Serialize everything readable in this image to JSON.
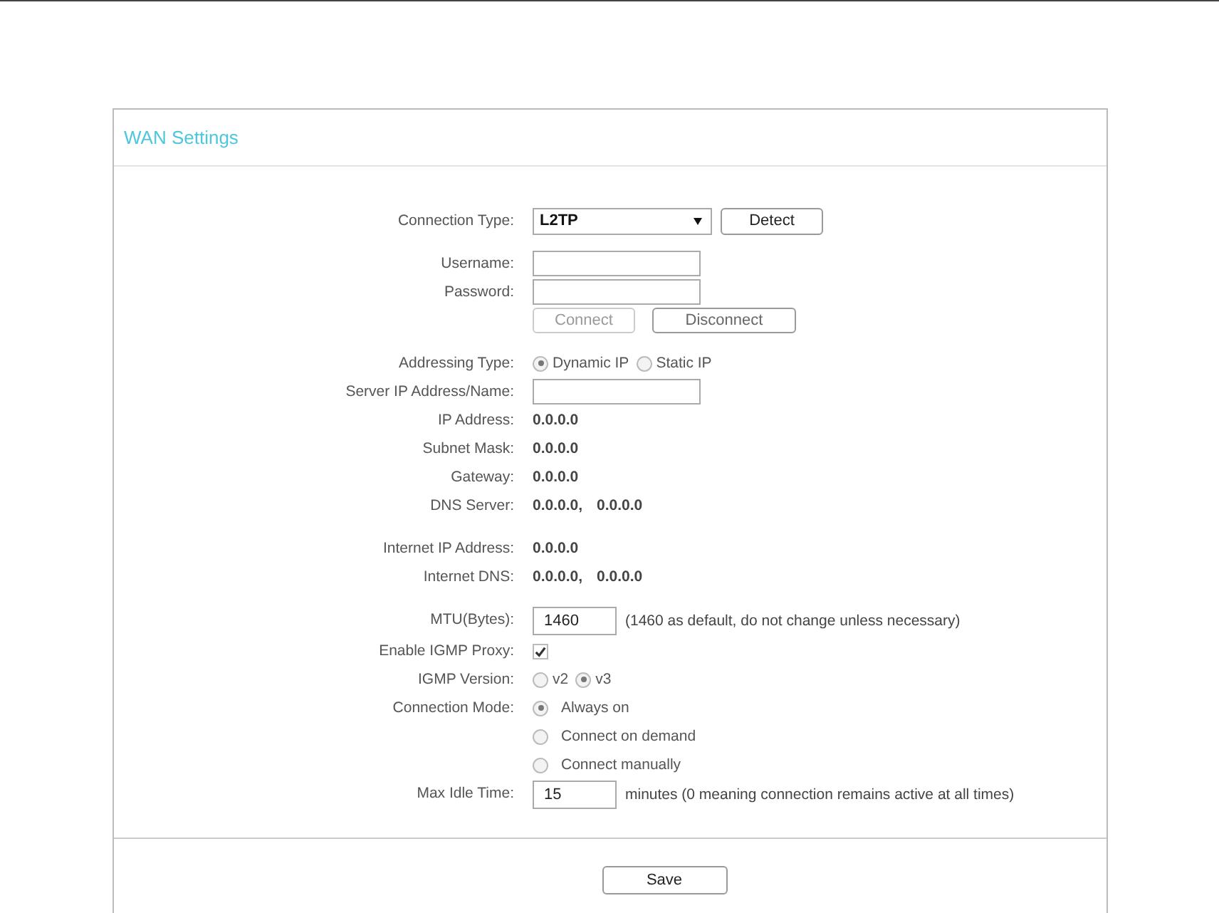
{
  "panel": {
    "title": "WAN Settings"
  },
  "sections": [
    [
      {
        "kind": "select",
        "label": "Connection Type:",
        "value": "L2TP",
        "button": "Detect"
      }
    ],
    [
      {
        "kind": "input",
        "label": "Username:"
      },
      {
        "kind": "input",
        "label": "Password:"
      },
      {
        "kind": "buttons",
        "buttons": [
          {
            "label": "Connect",
            "disabled": true
          },
          {
            "label": "Disconnect",
            "disabled": false
          }
        ]
      }
    ],
    [
      {
        "kind": "radio",
        "label": "Addressing Type:",
        "options": [
          {
            "label": "Dynamic IP",
            "selected": true
          },
          {
            "label": "Static IP",
            "selected": false
          }
        ]
      },
      {
        "kind": "input",
        "label": "Server IP Address/Name:"
      },
      {
        "kind": "value",
        "label": "IP Address:",
        "values": [
          "0.0.0.0"
        ]
      },
      {
        "kind": "value",
        "label": "Subnet Mask:",
        "values": [
          "0.0.0.0"
        ]
      },
      {
        "kind": "value",
        "label": "Gateway:",
        "values": [
          "0.0.0.0"
        ]
      },
      {
        "kind": "value",
        "label": "DNS Server:",
        "values": [
          "0.0.0.0,",
          "0.0.0.0"
        ]
      }
    ],
    [
      {
        "kind": "value",
        "label": "Internet IP Address:",
        "values": [
          "0.0.0.0"
        ]
      },
      {
        "kind": "value",
        "label": "Internet DNS:",
        "values": [
          "0.0.0.0,",
          "0.0.0.0"
        ]
      }
    ],
    [
      {
        "kind": "input",
        "label": "MTU(Bytes):",
        "value": "1460",
        "note": "(1460 as default, do not change unless necessary)"
      },
      {
        "kind": "checkbox",
        "label": "Enable IGMP Proxy:",
        "checked": true
      },
      {
        "kind": "radio",
        "label": "IGMP Version:",
        "options": [
          {
            "label": "v2",
            "selected": false
          },
          {
            "label": "v3",
            "selected": true
          }
        ]
      },
      {
        "kind": "radio-list",
        "label": "Connection Mode:",
        "options": [
          {
            "label": "Always on",
            "selected": true
          },
          {
            "label": "Connect on demand",
            "selected": false
          },
          {
            "label": "Connect manually",
            "selected": false
          }
        ]
      },
      {
        "kind": "input",
        "label": "Max Idle Time:",
        "value": "15",
        "note": "minutes (0 meaning connection remains active at all times)"
      }
    ]
  ],
  "save": "Save"
}
